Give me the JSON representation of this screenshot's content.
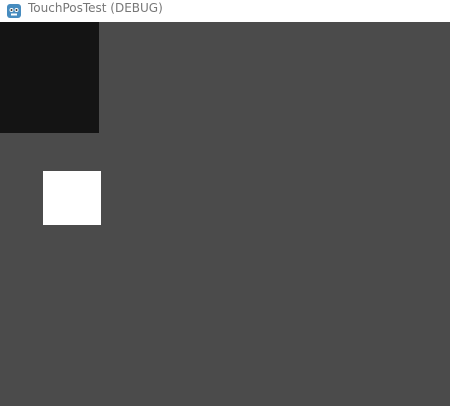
{
  "window": {
    "title": "TouchPosTest (DEBUG)",
    "app_icon": "godot-engine-icon"
  },
  "colors": {
    "titlebar_bg": "#ffffff",
    "title_text": "#777777",
    "viewport_bg": "#4b4b4b",
    "dark_rect": "#141414",
    "white_rect": "#ffffff"
  }
}
